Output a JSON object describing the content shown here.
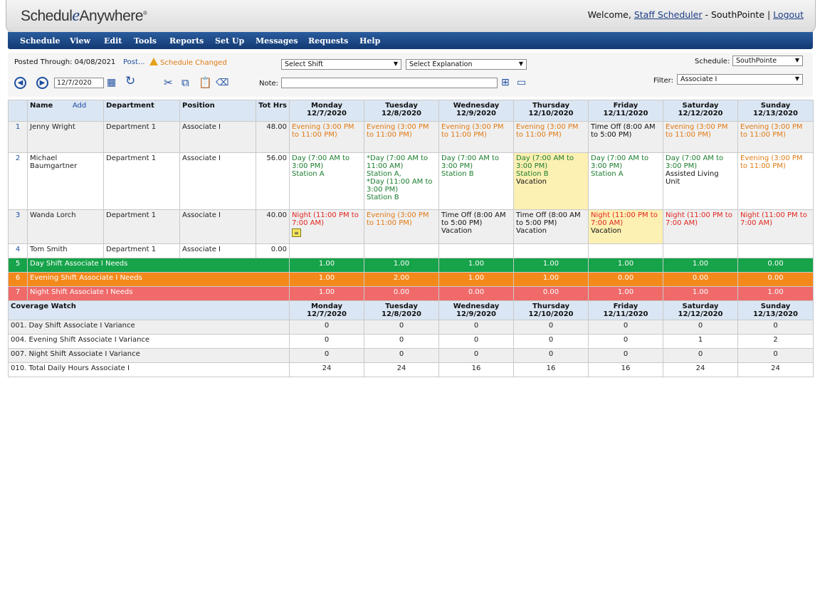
{
  "app": {
    "logo_left": "Schedul",
    "logo_e": "e",
    "logo_right": "Anywhere",
    "logo_reg": "®",
    "welcome": "Welcome,",
    "user": "Staff Scheduler",
    "separator": "- SouthPointe |",
    "logout": "Logout"
  },
  "menu": [
    "Schedule",
    "View",
    "Edit",
    "Tools",
    "Reports",
    "Set Up",
    "Messages",
    "Requests",
    "Help"
  ],
  "toolbar": {
    "posted_through": "Posted Through: 04/08/2021",
    "post_link": "Post...",
    "schedule_changed": "Schedule Changed",
    "select_shift": "Select Shift",
    "select_explanation": "Select Explanation",
    "schedule_label": "Schedule:",
    "schedule_value": "SouthPointe",
    "filter_label": "Filter:",
    "filter_value": "Associate I",
    "date_value": "12/7/2020",
    "note_label": "Note:",
    "note_value": ""
  },
  "grid": {
    "headers": {
      "name": "Name",
      "add": "Add",
      "department": "Department",
      "position": "Position",
      "tot_hrs": "Tot Hrs"
    },
    "days": [
      {
        "day": "Monday",
        "date": "12/7/2020"
      },
      {
        "day": "Tuesday",
        "date": "12/8/2020"
      },
      {
        "day": "Wednesday",
        "date": "12/9/2020"
      },
      {
        "day": "Thursday",
        "date": "12/10/2020"
      },
      {
        "day": "Friday",
        "date": "12/11/2020"
      },
      {
        "day": "Saturday",
        "date": "12/12/2020"
      },
      {
        "day": "Sunday",
        "date": "12/13/2020"
      }
    ],
    "employees": [
      {
        "num": "1",
        "name": "Jenny Wright",
        "department": "Department 1",
        "position": "Associate I",
        "hours": "48.00",
        "shifts": [
          {
            "type": "even",
            "lines": [
              "Evening (3:00 PM to 11:00 PM)"
            ]
          },
          {
            "type": "even",
            "lines": [
              "Evening (3:00 PM to 11:00 PM)"
            ]
          },
          {
            "type": "even",
            "lines": [
              "Evening (3:00 PM to 11:00 PM)"
            ]
          },
          {
            "type": "even",
            "lines": [
              "Evening (3:00 PM to 11:00 PM)"
            ]
          },
          {
            "type": "off",
            "lines": [
              "Time Off (8:00 AM to 5:00 PM)"
            ]
          },
          {
            "type": "even",
            "lines": [
              "Evening (3:00 PM to 11:00 PM)"
            ]
          },
          {
            "type": "even",
            "lines": [
              "Evening (3:00 PM to 11:00 PM)"
            ]
          }
        ]
      },
      {
        "num": "2",
        "name": "Michael Baumgartner",
        "department": "Department 1",
        "position": "Associate I",
        "hours": "56.00",
        "shifts": [
          {
            "type": "day",
            "lines": [
              "Day (7:00 AM to 3:00 PM)",
              "Station A"
            ]
          },
          {
            "type": "day",
            "lines": [
              "*Day (7:00 AM to 11:00 AM)",
              "Station A,",
              "*Day (11:00 AM to 3:00 PM)",
              "Station B"
            ]
          },
          {
            "type": "day",
            "lines": [
              "Day (7:00 AM to 3:00 PM)",
              "Station B"
            ]
          },
          {
            "type": "day",
            "vac": true,
            "lines": [
              "Day (7:00 AM to 3:00 PM)",
              "Station B"
            ],
            "extra": "Vacation"
          },
          {
            "type": "day",
            "lines": [
              "Day (7:00 AM to 3:00 PM)",
              "Station A"
            ]
          },
          {
            "type": "day",
            "lines": [
              "Day (7:00 AM to 3:00 PM)"
            ],
            "extra": "Assisted Living Unit"
          },
          {
            "type": "even",
            "lines": [
              "Evening (3:00 PM to 11:00 PM)"
            ]
          }
        ]
      },
      {
        "num": "3",
        "name": "Wanda Lorch",
        "department": "Department 1",
        "position": "Associate I",
        "hours": "40.00",
        "shifts": [
          {
            "type": "night",
            "lines": [
              "Night (11:00 PM to 7:00 AM)"
            ],
            "note": true
          },
          {
            "type": "even",
            "lines": [
              "Evening (3:00 PM to 11:00 PM)"
            ]
          },
          {
            "type": "off",
            "lines": [
              "Time Off (8:00 AM to 5:00 PM)"
            ],
            "extra": "Vacation"
          },
          {
            "type": "off",
            "lines": [
              "Time Off (8:00 AM to 5:00 PM)"
            ],
            "extra": "Vacation"
          },
          {
            "type": "night",
            "vac": true,
            "lines": [
              "Night (11:00 PM to 7:00 AM)"
            ],
            "extra": "Vacation"
          },
          {
            "type": "night",
            "lines": [
              "Night (11:00 PM to 7:00 AM)"
            ]
          },
          {
            "type": "night",
            "lines": [
              "Night (11:00 PM to 7:00 AM)"
            ]
          }
        ]
      },
      {
        "num": "4",
        "name": "Tom Smith",
        "department": "Department 1",
        "position": "Associate I",
        "hours": "0.00",
        "shifts": [
          {
            "type": "off",
            "lines": []
          },
          {
            "type": "off",
            "lines": []
          },
          {
            "type": "off",
            "lines": []
          },
          {
            "type": "off",
            "lines": []
          },
          {
            "type": "off",
            "lines": []
          },
          {
            "type": "off",
            "lines": []
          },
          {
            "type": "off",
            "lines": []
          }
        ]
      }
    ],
    "needs": [
      {
        "num": "5",
        "label": "Day Shift Associate I Needs",
        "cls": "need-day",
        "values": [
          "1.00",
          "1.00",
          "1.00",
          "1.00",
          "1.00",
          "1.00",
          "0.00"
        ]
      },
      {
        "num": "6",
        "label": "Evening Shift Associate I Needs",
        "cls": "need-even",
        "values": [
          "1.00",
          "2.00",
          "1.00",
          "1.00",
          "0.00",
          "0.00",
          "0.00"
        ]
      },
      {
        "num": "7",
        "label": "Night Shift Associate I Needs",
        "cls": "need-night",
        "values": [
          "1.00",
          "0.00",
          "0.00",
          "0.00",
          "1.00",
          "1.00",
          "1.00"
        ]
      }
    ],
    "coverage_title": "Coverage Watch",
    "coverage": [
      {
        "label": "001. Day Shift Associate I Variance",
        "values": [
          "0",
          "0",
          "0",
          "0",
          "0",
          "0",
          "0"
        ]
      },
      {
        "label": "004. Evening Shift Associate I Variance",
        "values": [
          "0",
          "0",
          "0",
          "0",
          "0",
          "1",
          "2"
        ]
      },
      {
        "label": "007. Night Shift Associate I Variance",
        "values": [
          "0",
          "0",
          "0",
          "0",
          "0",
          "0",
          "0"
        ]
      },
      {
        "label": "010. Total Daily Hours Associate I",
        "values": [
          "24",
          "24",
          "16",
          "16",
          "16",
          "24",
          "24"
        ]
      }
    ]
  }
}
